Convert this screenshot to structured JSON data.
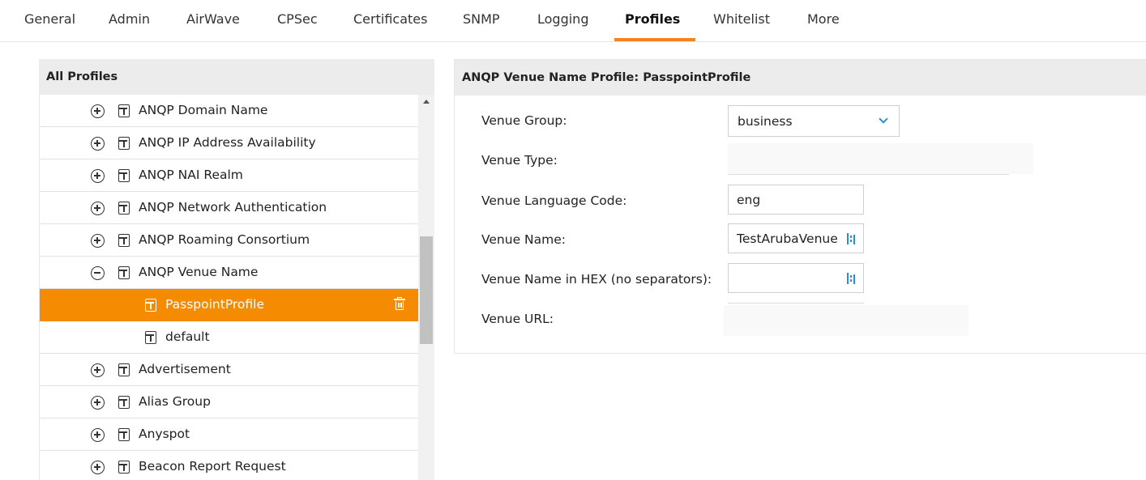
{
  "tabs": [
    "General",
    "Admin",
    "AirWave",
    "CPSec",
    "Certificates",
    "SNMP",
    "Logging",
    "Profiles",
    "Whitelist",
    "More"
  ],
  "active_tab": "Profiles",
  "left_panel": {
    "title": "All Profiles",
    "items": [
      {
        "label": "ANQP Domain Name",
        "toggle": "expand"
      },
      {
        "label": "ANQP IP Address Availability",
        "toggle": "expand"
      },
      {
        "label": "ANQP NAI Realm",
        "toggle": "expand"
      },
      {
        "label": "ANQP Network Authentication",
        "toggle": "expand"
      },
      {
        "label": "ANQP Roaming Consortium",
        "toggle": "expand"
      },
      {
        "label": "ANQP Venue Name",
        "toggle": "collapse"
      },
      {
        "label": "PasspointProfile",
        "child": true,
        "selected": true
      },
      {
        "label": "default",
        "child": true
      },
      {
        "label": "Advertisement",
        "toggle": "expand"
      },
      {
        "label": "Alias Group",
        "toggle": "expand"
      },
      {
        "label": "Anyspot",
        "toggle": "expand"
      },
      {
        "label": "Beacon Report Request",
        "toggle": "expand"
      }
    ]
  },
  "right_panel": {
    "title": "ANQP Venue Name Profile: PasspointProfile",
    "fields": {
      "venue_group": {
        "label": "Venue Group:",
        "value": "business"
      },
      "venue_type": {
        "label": "Venue Type:"
      },
      "venue_language_code": {
        "label": "Venue Language Code:",
        "value": "eng"
      },
      "venue_name": {
        "label": "Venue Name:",
        "value": "TestArubaVenue"
      },
      "venue_name_hex": {
        "label": "Venue Name in HEX (no separators):",
        "value": ""
      },
      "venue_url": {
        "label": "Venue URL:"
      }
    }
  },
  "colors": {
    "accent": "#f58220",
    "selected_row": "#f58b00",
    "header_bg": "#ececec",
    "icon_blue": "#2a8fd4"
  }
}
